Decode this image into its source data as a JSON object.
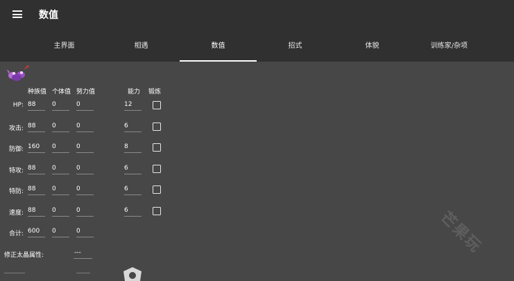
{
  "app": {
    "title": "数值"
  },
  "tabs": [
    {
      "label": "主界面"
    },
    {
      "label": "相遇"
    },
    {
      "label": "数值",
      "active": true
    },
    {
      "label": "招式"
    },
    {
      "label": "体貌"
    },
    {
      "label": "训练家/杂项"
    }
  ],
  "stats": {
    "headers": {
      "base": "种族值",
      "iv": "个体值",
      "ev": "努力值",
      "stat": "能力",
      "hypertrain": "锻炼"
    },
    "rows": [
      {
        "label": "HP:",
        "base": "88",
        "iv": "0",
        "ev": "0",
        "stat": "12",
        "hypertrain": false
      },
      {
        "label": "攻击:",
        "base": "88",
        "iv": "0",
        "ev": "0",
        "stat": "6",
        "hypertrain": false
      },
      {
        "label": "防御:",
        "base": "160",
        "iv": "0",
        "ev": "0",
        "stat": "8",
        "hypertrain": false
      },
      {
        "label": "特攻:",
        "base": "88",
        "iv": "0",
        "ev": "0",
        "stat": "6",
        "hypertrain": false
      },
      {
        "label": "特防:",
        "base": "88",
        "iv": "0",
        "ev": "0",
        "stat": "6",
        "hypertrain": false
      },
      {
        "label": "速度:",
        "base": "88",
        "iv": "0",
        "ev": "0",
        "stat": "6",
        "hypertrain": false
      }
    ],
    "total": {
      "label": "合计:",
      "base": "600",
      "iv": "0",
      "ev": "0"
    }
  },
  "tera": {
    "label": "修正太晶属性:",
    "value": "---"
  },
  "watermark": "芒果玩",
  "colors": {
    "appbar": "#303030",
    "background": "#474747",
    "indicator": "#ffffff"
  }
}
